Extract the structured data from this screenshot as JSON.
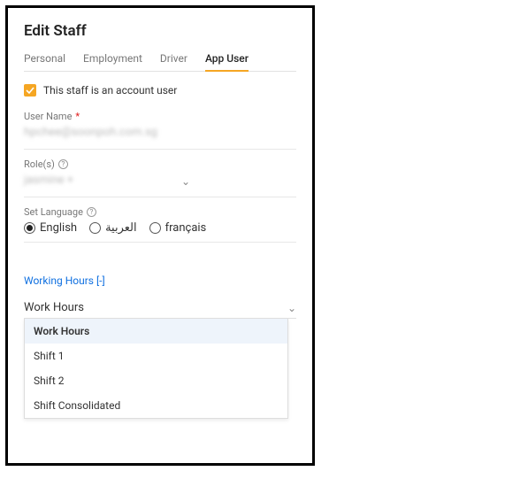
{
  "pageTitle": "Edit Staff",
  "tabs": {
    "personal": "Personal",
    "employment": "Employment",
    "driver": "Driver",
    "appUser": "App User"
  },
  "accountUser": {
    "checked": true,
    "label": "This staff is an account user"
  },
  "userName": {
    "label": "User Name",
    "required": "*",
    "value": "hpchee@soonpoh.com.sg"
  },
  "roles": {
    "label": "Role(s)",
    "value": "jasmine +"
  },
  "language": {
    "label": "Set Language",
    "options": {
      "en": "English",
      "ar": "العربية",
      "fr": "français"
    },
    "selected": "en"
  },
  "workingHoursToggle": "Working Hours [-]",
  "workHours": {
    "label": "Work Hours",
    "options": [
      "Work Hours",
      "Shift 1",
      "Shift 2",
      "Shift Consolidated"
    ],
    "selectedIndex": 0
  }
}
